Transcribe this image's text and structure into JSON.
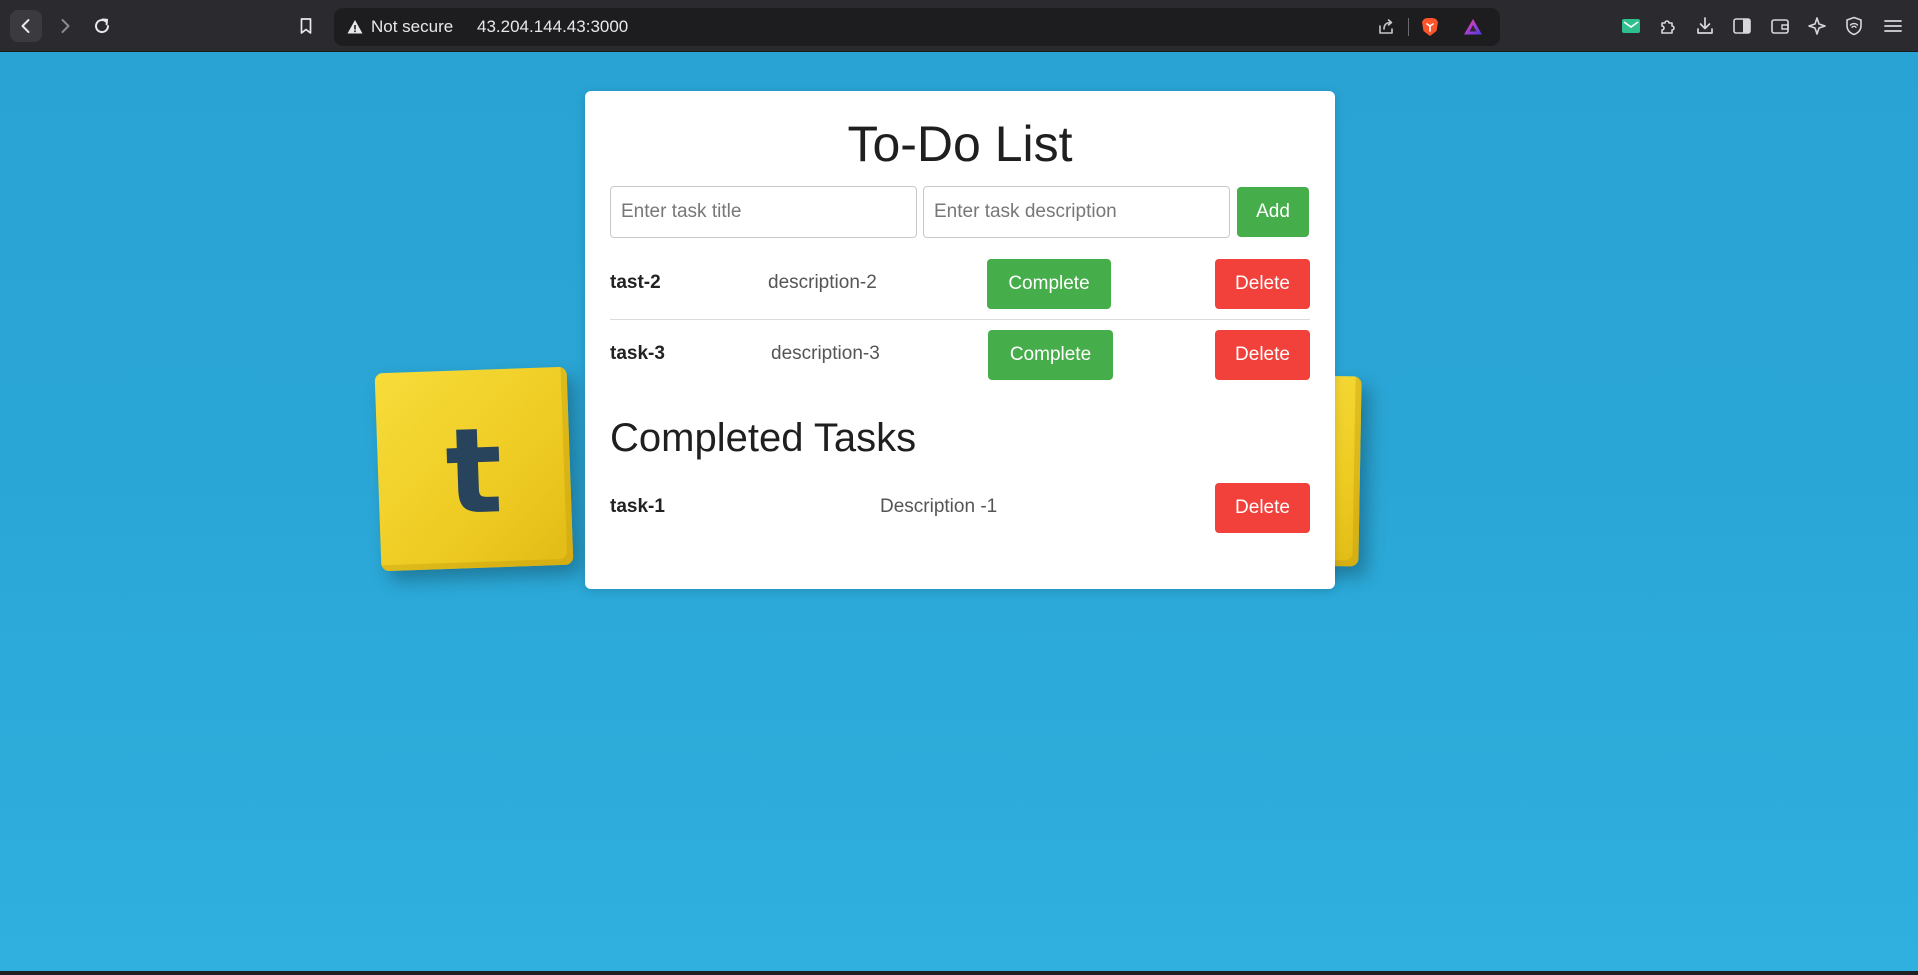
{
  "browser": {
    "security_label": "Not secure",
    "url": "43.204.144.43:3000"
  },
  "background": {
    "tile_letter": "t"
  },
  "app": {
    "title": "To-Do List",
    "title_input_placeholder": "Enter task title",
    "description_input_placeholder": "Enter task description",
    "add_label": "Add",
    "complete_label": "Complete",
    "delete_label": "Delete",
    "tasks": [
      {
        "title": "tast-2",
        "description": "description-2"
      },
      {
        "title": "task-3",
        "description": "description-3"
      }
    ],
    "completed_heading": "Completed Tasks",
    "completed_tasks": [
      {
        "title": "task-1",
        "description": "Description -1"
      }
    ]
  },
  "colors": {
    "complete_button": "#46ad4b",
    "delete_button": "#f2403a",
    "page_background": "#2aa6d6"
  }
}
